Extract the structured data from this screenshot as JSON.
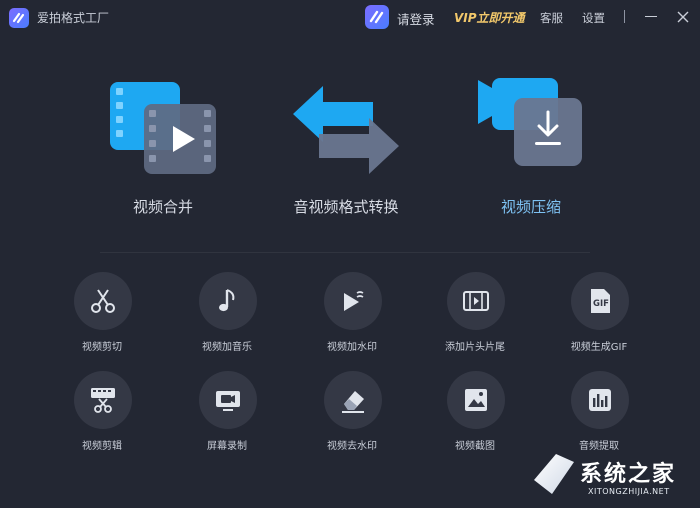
{
  "titlebar": {
    "app_title": "爱拍格式工厂",
    "login": "请登录",
    "vip": "VIP立即开通",
    "service": "客服",
    "settings": "设置"
  },
  "features": [
    {
      "label": "视频合并",
      "icon": "video-merge-icon"
    },
    {
      "label": "音视频格式转换",
      "icon": "format-convert-icon"
    },
    {
      "label": "视频压缩",
      "icon": "video-compress-icon",
      "active": true
    }
  ],
  "tools": [
    {
      "label": "视频剪切",
      "icon": "scissors-icon"
    },
    {
      "label": "视频加音乐",
      "icon": "music-note-icon"
    },
    {
      "label": "视频加水印",
      "icon": "play-watermark-icon"
    },
    {
      "label": "添加片头片尾",
      "icon": "film-strip-icon"
    },
    {
      "label": "视频生成GIF",
      "icon": "gif-icon"
    },
    {
      "label": "视频剪辑",
      "icon": "film-scissors-icon"
    },
    {
      "label": "屏幕录制",
      "icon": "screen-record-icon"
    },
    {
      "label": "视频去水印",
      "icon": "eraser-icon"
    },
    {
      "label": "视频截图",
      "icon": "image-icon"
    },
    {
      "label": "音频提取",
      "icon": "audio-bars-icon"
    }
  ],
  "gif_badge": "GIF",
  "watermark": {
    "title": "系统之家",
    "url": "XITONGZHIJIA.NET"
  },
  "colors": {
    "background": "#232733",
    "accent_blue": "#1fa6f0",
    "active_label": "#7ec2f3",
    "vip_gold": "#f2c86b",
    "tool_circle": "#343845"
  }
}
